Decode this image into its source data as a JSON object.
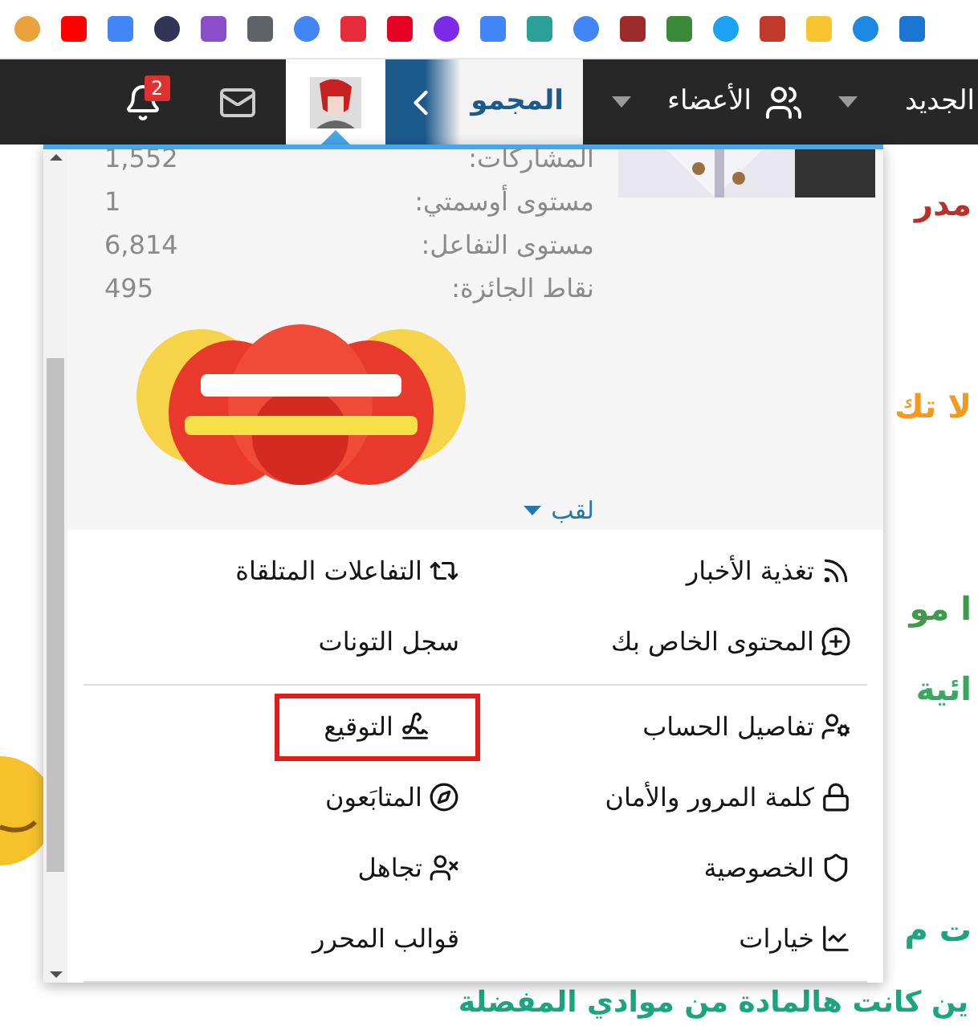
{
  "nav": {
    "notifications_badge": "2",
    "group_label": "المجمو",
    "members_label": "الأعضاء",
    "new_label": "الجديد"
  },
  "profile_menu": {
    "stats": [
      {
        "label": "المشاركات:",
        "value": "1,552"
      },
      {
        "label": "مستوى أوسمتي:",
        "value": "1"
      },
      {
        "label": "مستوى التفاعل:",
        "value": "6,814"
      },
      {
        "label": "نقاط الجائزة:",
        "value": "495"
      }
    ],
    "title_link": "لقب",
    "sections": [
      {
        "items": [
          {
            "label": "تغذية الأخبار",
            "highlighted": false
          },
          {
            "label": "التفاعلات المتلقاة",
            "highlighted": false
          },
          {
            "label": "المحتوى الخاص بك",
            "highlighted": false
          },
          {
            "label": "سجل التونات",
            "highlighted": false
          }
        ]
      },
      {
        "items": [
          {
            "label": "تفاصيل الحساب",
            "highlighted": false
          },
          {
            "label": "التوقيع",
            "highlighted": true
          },
          {
            "label": "كلمة المرور والأمان",
            "highlighted": false
          },
          {
            "label": "المتابَعون",
            "highlighted": false
          },
          {
            "label": "الخصوصية",
            "highlighted": false
          },
          {
            "label": "تجاهل",
            "highlighted": false
          },
          {
            "label": "خيارات",
            "highlighted": false
          },
          {
            "label": "قوالب المحرر",
            "highlighted": false
          }
        ]
      }
    ]
  },
  "page_text": [
    {
      "text": "مدر",
      "color": "#b8322c"
    },
    {
      "text": "لا تك",
      "color": "#f39a1e"
    },
    {
      "text": "ا مو",
      "color": "#3f9a4c"
    },
    {
      "text": "ائية",
      "color": "#3aa85e"
    },
    {
      "text": "ت م",
      "color": "#1ba57f"
    }
  ],
  "bottom_text": {
    "text": "ين كانت هالمادة من موادي المفضلة",
    "color": "#1ba57f"
  }
}
